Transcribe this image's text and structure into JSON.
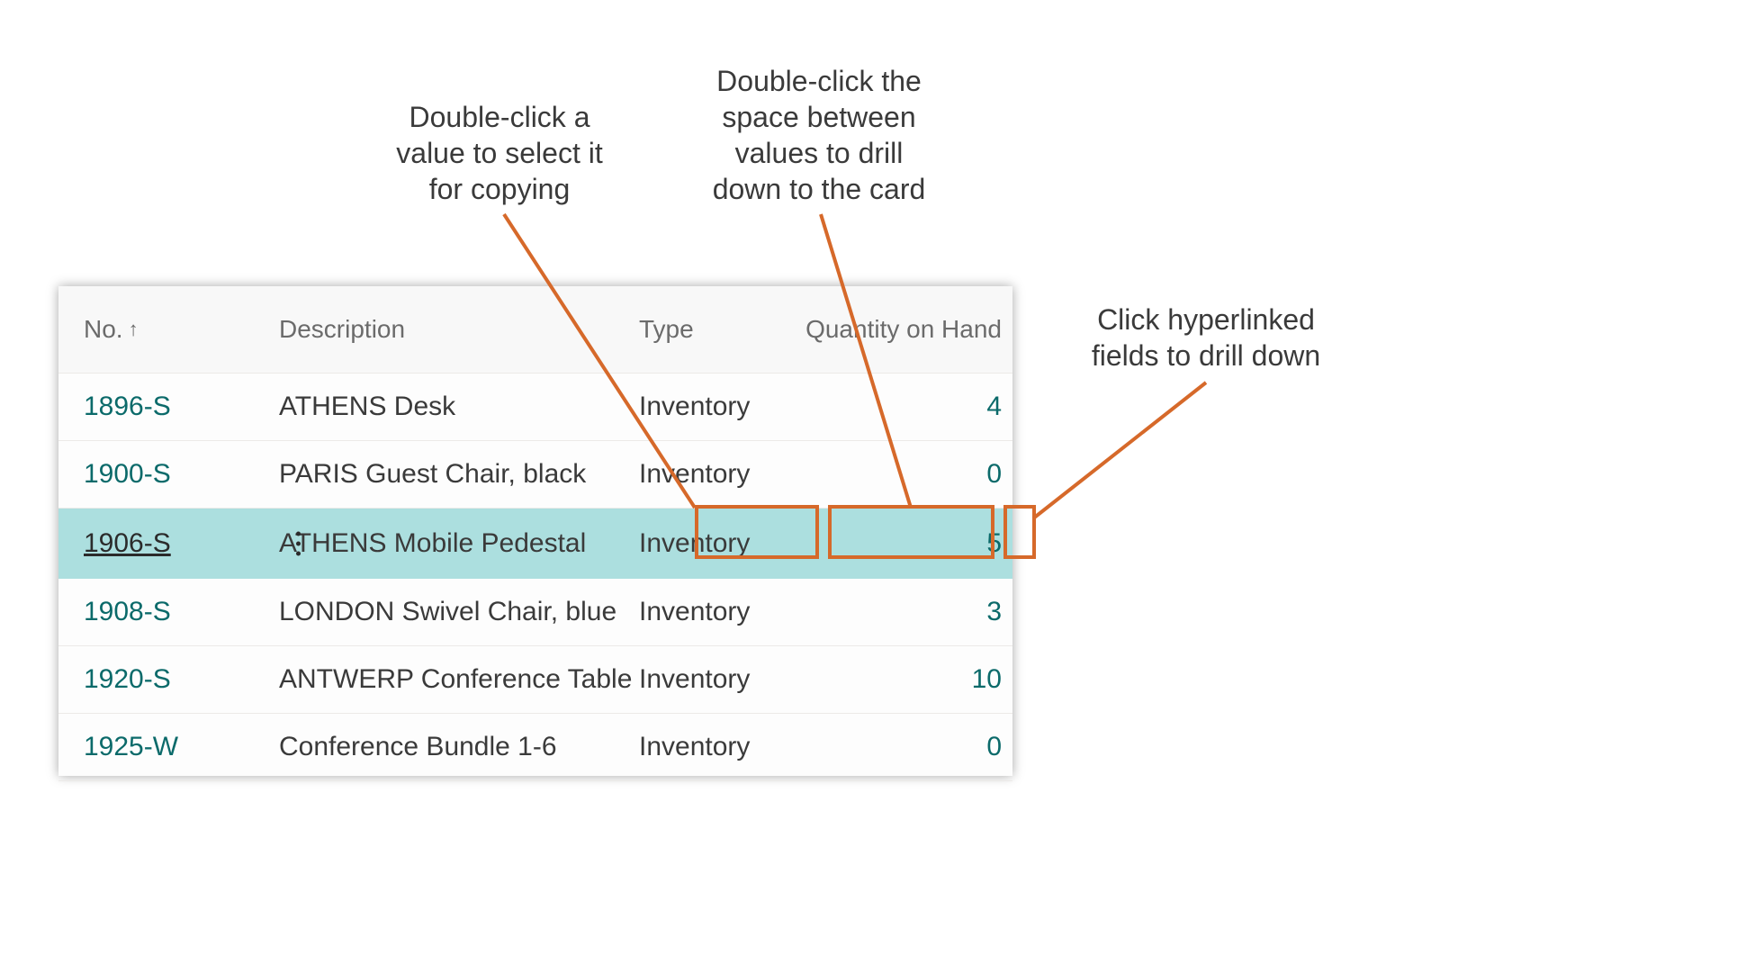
{
  "callouts": {
    "copy": "Double-click a\nvalue to select it\nfor copying",
    "drill_card": "Double-click the\nspace between\nvalues to drill\ndown to the card",
    "hyperlink": "Click hyperlinked\nfields to drill down"
  },
  "headers": {
    "no": "No.",
    "description": "Description",
    "type": "Type",
    "qty": "Quantity on Hand"
  },
  "rows": [
    {
      "no": "1896-S",
      "description": "ATHENS Desk",
      "type": "Inventory",
      "qty": "4",
      "selected": false
    },
    {
      "no": "1900-S",
      "description": "PARIS Guest Chair, black",
      "type": "Inventory",
      "qty": "0",
      "selected": false
    },
    {
      "no": "1906-S",
      "description": "ATHENS Mobile Pedestal",
      "type": "Inventory",
      "qty": "5",
      "selected": true
    },
    {
      "no": "1908-S",
      "description": "LONDON Swivel Chair, blue",
      "type": "Inventory",
      "qty": "3",
      "selected": false
    },
    {
      "no": "1920-S",
      "description": "ANTWERP Conference Table",
      "type": "Inventory",
      "qty": "10",
      "selected": false
    },
    {
      "no": "1925-W",
      "description": "Conference Bundle 1-6",
      "type": "Inventory",
      "qty": "0",
      "selected": false
    }
  ],
  "colors": {
    "accent": "#d6692a",
    "link": "#0b6a6a",
    "selected_bg": "#acdfdf"
  }
}
